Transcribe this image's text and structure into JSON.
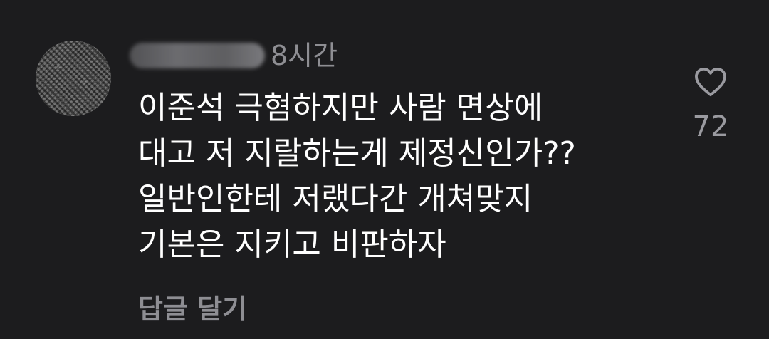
{
  "comment": {
    "username": "",
    "timestamp": "8시간",
    "lines": [
      "이준석 극혐하지만 사람 면상에",
      "대고 저 지랄하는게 제정신인가??",
      "일반인한테 저랬다간 개쳐맞지",
      "기본은 지키고 비판하자"
    ],
    "like_count": "72",
    "like_icon": "heart-outline-icon",
    "reply_label": "답글 달기"
  },
  "colors": {
    "background": "#1c1c1e",
    "text_primary": "#ffffff",
    "text_secondary": "#8e8e93"
  }
}
